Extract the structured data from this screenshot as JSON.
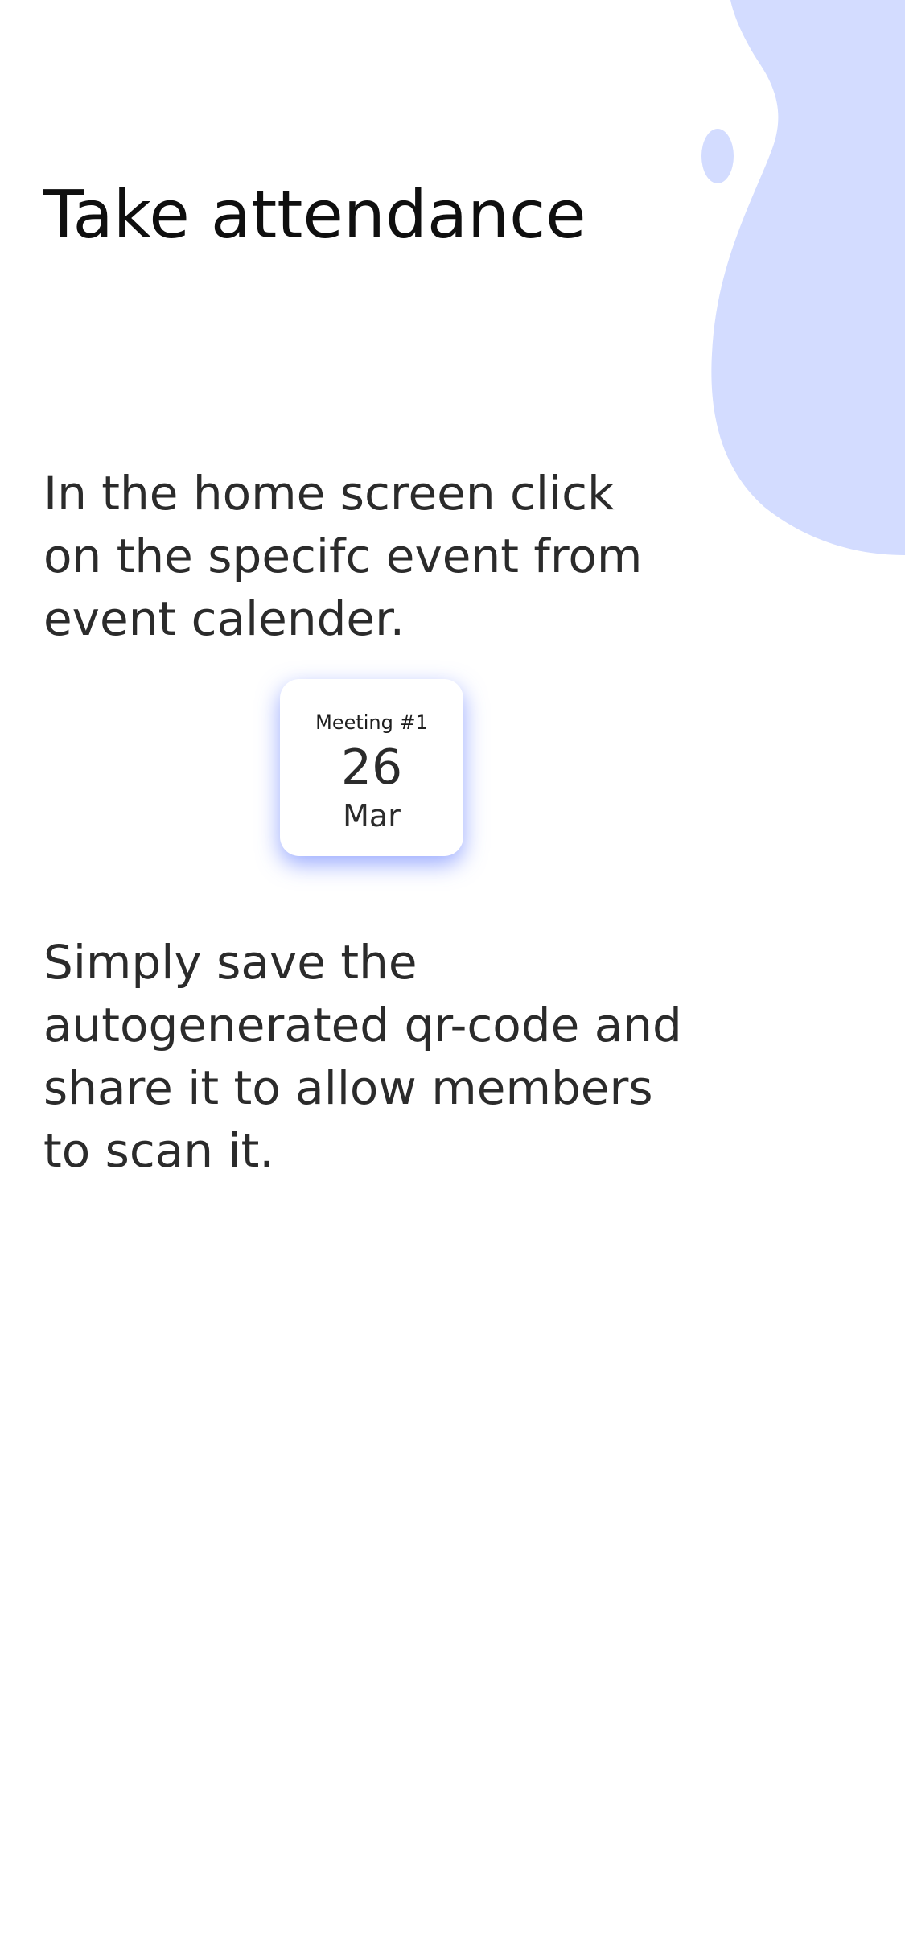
{
  "colors": {
    "blob": "#d3dcff",
    "card_shadow": "#4664ff",
    "text": "#2b2b2b",
    "title": "#0f0f0f"
  },
  "header": {
    "title": "Take attendance"
  },
  "steps": [
    {
      "text": "In the home screen click on the specifc event from event calender."
    },
    {
      "text": "Simply save the autogenerated qr-code and share it to allow members to scan it."
    }
  ],
  "event_card": {
    "name": "Meeting #1",
    "day": "26",
    "month": "Mar"
  }
}
